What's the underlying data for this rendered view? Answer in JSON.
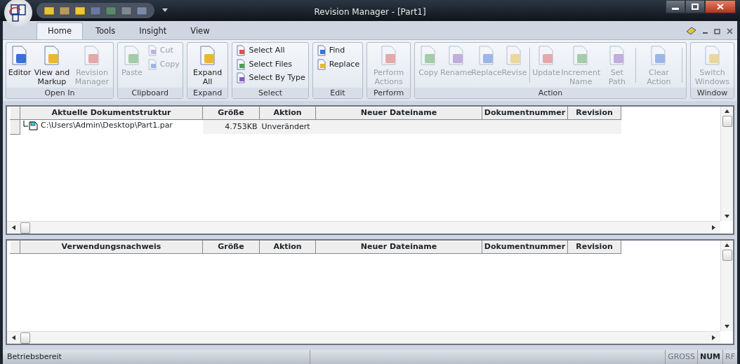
{
  "window": {
    "title": "Revision Manager - [Part1]"
  },
  "tabs": [
    {
      "label": "Home",
      "selected": true
    },
    {
      "label": "Tools",
      "selected": false
    },
    {
      "label": "Insight",
      "selected": false
    },
    {
      "label": "View",
      "selected": false
    }
  ],
  "ribbon_groups": [
    {
      "label": "Open In",
      "buttons": [
        {
          "kind": "large",
          "label": "Editor",
          "disabled": false
        },
        {
          "kind": "large",
          "label": "View and Markup",
          "disabled": false
        },
        {
          "kind": "large",
          "label": "Revision Manager",
          "disabled": true
        }
      ]
    },
    {
      "label": "Clipboard",
      "buttons": [
        {
          "kind": "large",
          "label": "Paste",
          "disabled": true
        },
        {
          "kind": "small",
          "label": "Cut",
          "disabled": true
        },
        {
          "kind": "small",
          "label": "Copy",
          "disabled": true
        }
      ]
    },
    {
      "label": "Expand",
      "buttons": [
        {
          "kind": "large",
          "label": "Expand All",
          "disabled": false
        }
      ]
    },
    {
      "label": "Select",
      "buttons": [
        {
          "kind": "small",
          "label": "Select All",
          "disabled": false
        },
        {
          "kind": "small",
          "label": "Select Files",
          "disabled": false
        },
        {
          "kind": "small",
          "label": "Select By Type",
          "disabled": false
        }
      ]
    },
    {
      "label": "Edit",
      "buttons": [
        {
          "kind": "small",
          "label": "Find",
          "disabled": false
        },
        {
          "kind": "small",
          "label": "Replace",
          "disabled": false
        }
      ]
    },
    {
      "label": "Perform",
      "buttons": [
        {
          "kind": "large",
          "label": "Perform Actions",
          "disabled": true
        }
      ]
    },
    {
      "label": "Action",
      "buttons": [
        {
          "kind": "large",
          "label": "Copy",
          "disabled": true
        },
        {
          "kind": "large",
          "label": "Rename",
          "disabled": true
        },
        {
          "kind": "large",
          "label": "Replace",
          "disabled": true
        },
        {
          "kind": "large",
          "label": "Revise",
          "disabled": true
        },
        {
          "kind": "separator"
        },
        {
          "kind": "large",
          "label": "Update",
          "disabled": true
        },
        {
          "kind": "large",
          "label": "Increment Name",
          "disabled": true
        },
        {
          "kind": "large",
          "label": "Set Path",
          "disabled": true
        },
        {
          "kind": "separator"
        },
        {
          "kind": "large",
          "label": "Clear Action",
          "disabled": true
        },
        {
          "kind": "separator"
        }
      ]
    },
    {
      "label": "Window",
      "buttons": [
        {
          "kind": "large",
          "label": "Switch Windows",
          "disabled": true
        }
      ]
    }
  ],
  "upper_table": {
    "columns": [
      "Aktuelle Dokumentstruktur",
      "Größe",
      "Aktion",
      "Neuer Dateiname",
      "Dokumentnummer",
      "Revision"
    ],
    "rows": [
      {
        "cells": [
          "C:\\Users\\Admin\\Desktop\\Part1.par",
          "4.753KB",
          "Unverändert",
          "",
          "",
          ""
        ]
      }
    ]
  },
  "lower_table": {
    "columns": [
      "Verwendungsnachweis",
      "Größe",
      "Aktion",
      "Neuer Dateiname",
      "Dokumentnummer",
      "Revision"
    ]
  },
  "status_bar": {
    "text": "Betriebsbereit",
    "indicators": [
      {
        "label": "GROSS",
        "disabled": true
      },
      {
        "label": "NUM",
        "disabled": false
      },
      {
        "label": "RF",
        "disabled": true
      }
    ]
  }
}
